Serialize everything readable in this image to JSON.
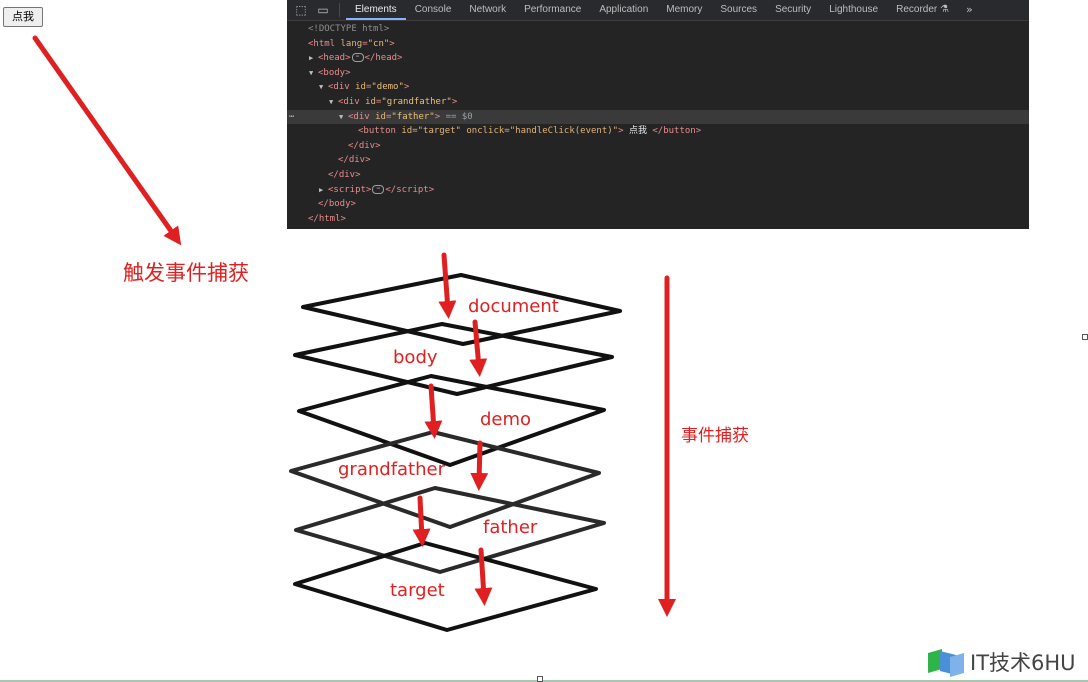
{
  "page": {
    "button_label": "点我"
  },
  "devtools": {
    "tabs": [
      "Elements",
      "Console",
      "Network",
      "Performance",
      "Application",
      "Memory",
      "Sources",
      "Security",
      "Lighthouse",
      "Recorder"
    ],
    "active_tab": "Elements",
    "more_label": "»",
    "dom_lines": [
      {
        "type": "doctype",
        "text": "<!DOCTYPE html>"
      },
      {
        "type": "open",
        "tag": "html",
        "attr": "lang",
        "value": "\"cn\""
      },
      {
        "type": "collapsed",
        "tag": "head"
      },
      {
        "type": "open",
        "tag": "body"
      },
      {
        "type": "open",
        "tag": "div",
        "attr": "id",
        "value": "\"demo\""
      },
      {
        "type": "open",
        "tag": "div",
        "attr": "id",
        "value": "\"grandfather\""
      },
      {
        "type": "open",
        "tag": "div",
        "attr": "id",
        "value": "\"father\"",
        "suffix": "== $0"
      },
      {
        "type": "inline",
        "tag": "button",
        "attrs": "id=\"target\" onclick=\"handleClick(event)\"",
        "text": " 点我 "
      },
      {
        "type": "close",
        "tag": "div"
      },
      {
        "type": "close",
        "tag": "div"
      },
      {
        "type": "close",
        "tag": "div"
      },
      {
        "type": "collapsed",
        "tag": "script"
      },
      {
        "type": "close",
        "tag": "body"
      },
      {
        "type": "close",
        "tag": "html"
      }
    ]
  },
  "annotations": {
    "trigger_label": "触发事件捕获",
    "side_label": "事件捕获",
    "layers": [
      "document",
      "body",
      "demo",
      "grandfather",
      "father",
      "target"
    ]
  },
  "watermark": {
    "text": "IT技术6HU"
  },
  "colors": {
    "annotation_red": "#e02020",
    "devtools_bg": "#242424"
  }
}
